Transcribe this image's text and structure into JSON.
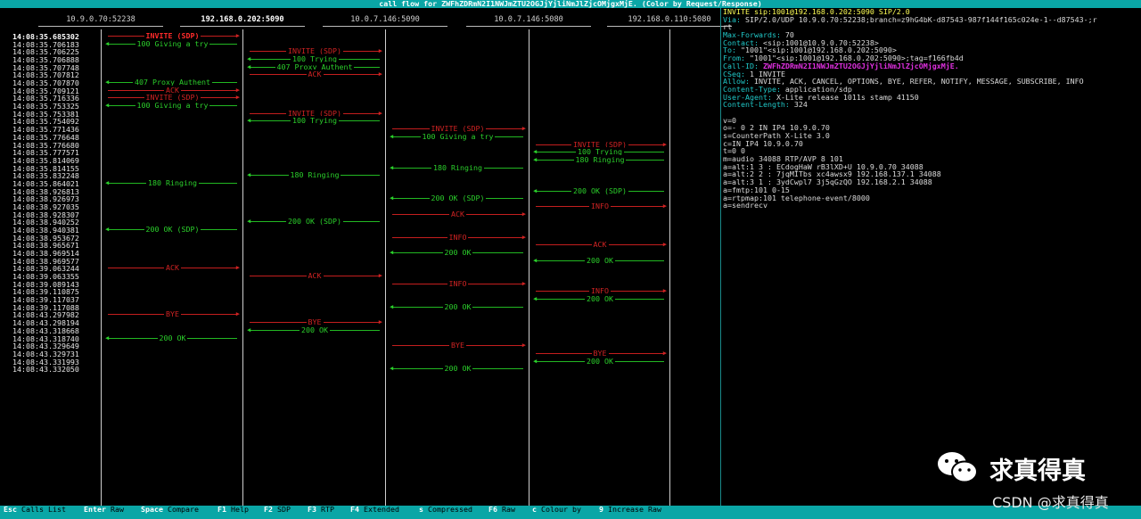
{
  "window_title": "call flow for ZWFhZDRmN2I1NWJmZTU2OGJjYjliNmJlZjcOMjgxMjE. (Color by Request/Response)",
  "columns": [
    {
      "label": "10.9.0.70:52238",
      "selected": false
    },
    {
      "label": "192.168.0.202:5090",
      "selected": true
    },
    {
      "label": "10.0.7.146:5090",
      "selected": false
    },
    {
      "label": "10.0.7.146:5080",
      "selected": false
    },
    {
      "label": "192.168.0.110:5080",
      "selected": false
    }
  ],
  "messages": [
    {
      "time": "14:08:35.685302",
      "from": 0,
      "to": 1,
      "label": "INVITE (SDP)",
      "color": "red",
      "selected": true
    },
    {
      "time": "14:08:35.706183",
      "from": 1,
      "to": 0,
      "label": "100 Giving a try",
      "color": "green"
    },
    {
      "time": "14:08:35.706225",
      "from": 1,
      "to": 2,
      "label": "INVITE (SDP)",
      "color": "red"
    },
    {
      "time": "14:08:35.706888",
      "from": 2,
      "to": 1,
      "label": "100 Trying",
      "color": "green"
    },
    {
      "time": "14:08:35.707748",
      "from": 2,
      "to": 1,
      "label": "407 Proxy Authent",
      "color": "green"
    },
    {
      "time": "14:08:35.707812",
      "from": 1,
      "to": 2,
      "label": "ACK",
      "color": "red"
    },
    {
      "time": "14:08:35.707870",
      "from": 1,
      "to": 0,
      "label": "407 Proxy Authent",
      "color": "green"
    },
    {
      "time": "14:08:35.709121",
      "from": 0,
      "to": 1,
      "label": "ACK",
      "color": "red"
    },
    {
      "time": "14:08:35.716336",
      "from": 0,
      "to": 1,
      "label": "INVITE (SDP)",
      "color": "red"
    },
    {
      "time": "14:08:35.753325",
      "from": 1,
      "to": 0,
      "label": "100 Giving a try",
      "color": "green"
    },
    {
      "time": "14:08:35.753381",
      "from": 1,
      "to": 2,
      "label": "INVITE (SDP)",
      "color": "red"
    },
    {
      "time": "14:08:35.754092",
      "from": 2,
      "to": 1,
      "label": "100 Trying",
      "color": "green"
    },
    {
      "time": "14:08:35.771436",
      "from": 2,
      "to": 3,
      "label": "INVITE (SDP)",
      "color": "red"
    },
    {
      "time": "14:08:35.776648",
      "from": 3,
      "to": 2,
      "label": "100 Giving a try",
      "color": "green"
    },
    {
      "time": "14:08:35.776680",
      "from": 3,
      "to": 4,
      "label": "INVITE (SDP)",
      "color": "red"
    },
    {
      "time": "14:08:35.777571",
      "from": 4,
      "to": 3,
      "label": "100 Trying",
      "color": "green"
    },
    {
      "time": "14:08:35.814069",
      "from": 4,
      "to": 3,
      "label": "180 Ringing",
      "color": "green"
    },
    {
      "time": "14:08:35.814155",
      "from": 3,
      "to": 2,
      "label": "180 Ringing",
      "color": "green"
    },
    {
      "time": "14:08:35.832248",
      "from": 2,
      "to": 1,
      "label": "180 Ringing",
      "color": "green"
    },
    {
      "time": "14:08:35.864021",
      "from": 1,
      "to": 0,
      "label": "180 Ringing",
      "color": "green"
    },
    {
      "time": "14:08:38.926813",
      "from": 4,
      "to": 3,
      "label": "200 OK (SDP)",
      "color": "green"
    },
    {
      "time": "14:08:38.926973",
      "from": 3,
      "to": 2,
      "label": "200 OK (SDP)",
      "color": "green"
    },
    {
      "time": "14:08:38.927035",
      "from": 3,
      "to": 4,
      "label": "INFO",
      "color": "red"
    },
    {
      "time": "14:08:38.928307",
      "from": 2,
      "to": 3,
      "label": "ACK",
      "color": "red"
    },
    {
      "time": "14:08:38.940252",
      "from": 2,
      "to": 1,
      "label": "200 OK (SDP)",
      "color": "green"
    },
    {
      "time": "14:08:38.940381",
      "from": 1,
      "to": 0,
      "label": "200 OK (SDP)",
      "color": "green"
    },
    {
      "time": "14:08:38.953672",
      "from": 2,
      "to": 3,
      "label": "INFO",
      "color": "red"
    },
    {
      "time": "14:08:38.965671",
      "from": 3,
      "to": 4,
      "label": "ACK",
      "color": "red"
    },
    {
      "time": "14:08:38.969514",
      "from": 3,
      "to": 2,
      "label": "200 OK",
      "color": "green"
    },
    {
      "time": "14:08:38.969577",
      "from": 4,
      "to": 3,
      "label": "200 OK",
      "color": "green"
    },
    {
      "time": "14:08:39.063244",
      "from": 0,
      "to": 1,
      "label": "ACK",
      "color": "red"
    },
    {
      "time": "14:08:39.063355",
      "from": 1,
      "to": 2,
      "label": "ACK",
      "color": "red"
    },
    {
      "time": "14:08:39.089143",
      "from": 2,
      "to": 3,
      "label": "INFO",
      "color": "red"
    },
    {
      "time": "14:08:39.110875",
      "from": 3,
      "to": 4,
      "label": "INFO",
      "color": "red"
    },
    {
      "time": "14:08:39.117037",
      "from": 4,
      "to": 3,
      "label": "200 OK",
      "color": "green"
    },
    {
      "time": "14:08:39.117088",
      "from": 3,
      "to": 2,
      "label": "200 OK",
      "color": "green"
    },
    {
      "time": "14:08:43.297982",
      "from": 0,
      "to": 1,
      "label": "BYE",
      "color": "red"
    },
    {
      "time": "14:08:43.298194",
      "from": 1,
      "to": 2,
      "label": "BYE",
      "color": "red"
    },
    {
      "time": "14:08:43.318668",
      "from": 2,
      "to": 1,
      "label": "200 OK",
      "color": "green"
    },
    {
      "time": "14:08:43.318740",
      "from": 1,
      "to": 0,
      "label": "200 OK",
      "color": "green"
    },
    {
      "time": "14:08:43.329649",
      "from": 2,
      "to": 3,
      "label": "BYE",
      "color": "red"
    },
    {
      "time": "14:08:43.329731",
      "from": 3,
      "to": 4,
      "label": "BYE",
      "color": "red"
    },
    {
      "time": "14:08:43.331993",
      "from": 4,
      "to": 3,
      "label": "200 OK",
      "color": "green"
    },
    {
      "time": "14:08:43.332050",
      "from": 3,
      "to": 2,
      "label": "200 OK",
      "color": "green"
    }
  ],
  "detail": {
    "lines": [
      {
        "k": "",
        "v": "INVITE sip:1001@192.168.0.202:5090 SIP/2.0"
      },
      {
        "k": "Via:",
        "v": " SIP/2.0/UDP 10.9.0.70:52238;branch=z9hG4bK-d87543-987f144f165c024e-1--d87543-;r"
      },
      {
        "k": "",
        "v": "rt"
      },
      {
        "k": "Max-Forwards:",
        "v": " 70"
      },
      {
        "k": "Contact:",
        "v": " <sip:1001@10.9.0.70:52238>"
      },
      {
        "k": "To:",
        "v": " \"1001\"<sip:1001@192.168.0.202:5090>"
      },
      {
        "k": "From:",
        "v": " \"1001\"<sip:1001@192.168.0.202:5090>;tag=f166fb4d"
      },
      {
        "k": "Call-ID:",
        "v": " ",
        "hl": "ZWFhZDRmN2I1NWJmZTU2OGJjYjliNmJlZjcOMjgxMjE."
      },
      {
        "k": "CSeq:",
        "v": " 1 INVITE"
      },
      {
        "k": "Allow:",
        "v": " INVITE, ACK, CANCEL, OPTIONS, BYE, REFER, NOTIFY, MESSAGE, SUBSCRIBE, INFO"
      },
      {
        "k": "Content-Type:",
        "v": " application/sdp"
      },
      {
        "k": "User-Agent:",
        "v": " X-Lite release 1011s stamp 41150"
      },
      {
        "k": "Content-Length:",
        "v": " 324"
      },
      {
        "k": "",
        "v": ""
      },
      {
        "k": "",
        "v": "v=0"
      },
      {
        "k": "",
        "v": "o=- 0 2 IN IP4 10.9.0.70"
      },
      {
        "k": "",
        "v": "s=CounterPath X-Lite 3.0"
      },
      {
        "k": "",
        "v": "c=IN IP4 10.9.0.70"
      },
      {
        "k": "",
        "v": "t=0 0"
      },
      {
        "k": "",
        "v": "m=audio 34088 RTP/AVP 8 101"
      },
      {
        "k": "",
        "v": "a=alt:1 3 : ECdogHaW rB3lXD+U 10.9.0.70 34088"
      },
      {
        "k": "",
        "v": "a=alt:2 2 : 7jqMITbs xc4awsx9 192.168.137.1 34088"
      },
      {
        "k": "",
        "v": "a=alt:3 1 : 3ydCwpl7 3j5qGzQO 192.168.2.1 34088"
      },
      {
        "k": "",
        "v": "a=fmtp:101 0-15"
      },
      {
        "k": "",
        "v": "a=rtpmap:101 telephone-event/8000"
      },
      {
        "k": "",
        "v": "a=sendrecv"
      }
    ]
  },
  "footer": [
    {
      "key": "Esc",
      "label": "Calls List"
    },
    {
      "key": "Enter",
      "label": "Raw"
    },
    {
      "key": "Space",
      "label": "Compare"
    },
    {
      "key": "F1",
      "label": "Help"
    },
    {
      "key": "F2",
      "label": "SDP"
    },
    {
      "key": "F3",
      "label": "RTP"
    },
    {
      "key": "F4",
      "label": "Extended"
    },
    {
      "key": "s",
      "label": "Compressed"
    },
    {
      "key": "F6",
      "label": "Raw"
    },
    {
      "key": "c",
      "label": "Colour by"
    },
    {
      "key": "9",
      "label": "Increase Raw"
    }
  ],
  "watermark": {
    "name": "求真得真",
    "csdn": "CSDN @求真得真"
  }
}
